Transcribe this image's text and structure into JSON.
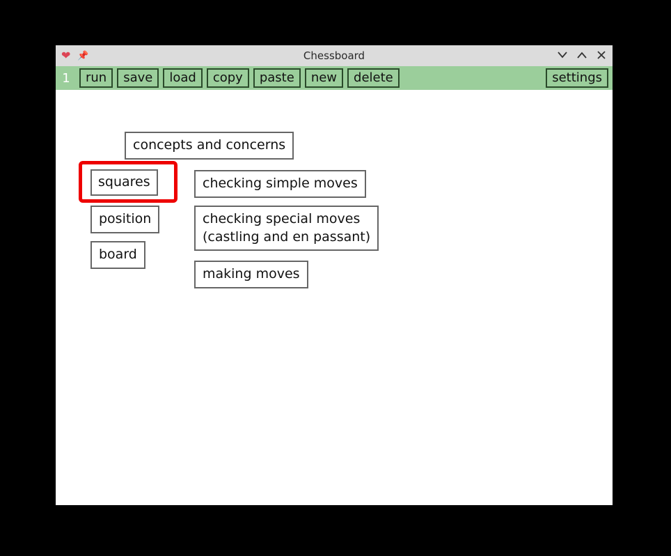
{
  "window": {
    "title": "Chessboard"
  },
  "toolbar": {
    "line_number": "1",
    "buttons": {
      "run": "run",
      "save": "save",
      "load": "load",
      "copy": "copy",
      "paste": "paste",
      "new": "new",
      "delete": "delete",
      "settings": "settings"
    }
  },
  "nodes": {
    "root": "concepts and concerns",
    "squares": "squares",
    "position": "position",
    "board": "board",
    "simple_moves": "checking simple moves",
    "special_moves": "checking special moves\n(castling and en passant)",
    "making_moves": "making moves"
  }
}
